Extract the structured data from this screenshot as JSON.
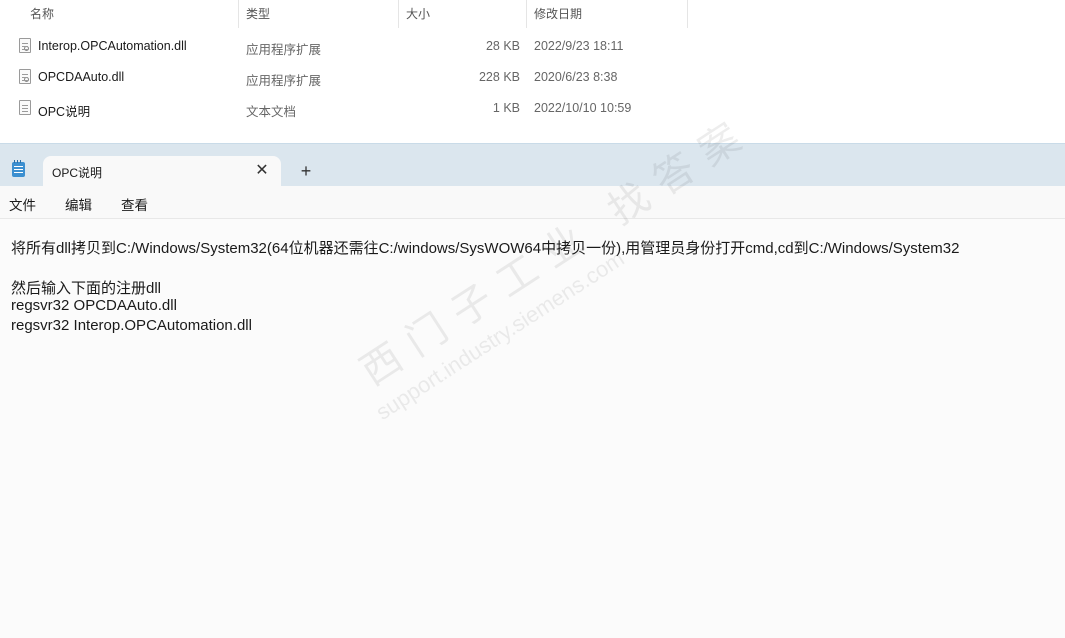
{
  "explorer": {
    "columns": {
      "name": "名称",
      "type": "类型",
      "size": "大小",
      "date": "修改日期"
    },
    "files": [
      {
        "name": "Interop.OPCAutomation.dll",
        "type": "应用程序扩展",
        "size": "28 KB",
        "date": "2022/9/23 18:11",
        "icon": "dll-file-icon"
      },
      {
        "name": "OPCDAAuto.dll",
        "type": "应用程序扩展",
        "size": "228 KB",
        "date": "2020/6/23 8:38",
        "icon": "dll-file-icon"
      },
      {
        "name": "OPC说明",
        "type": "文本文档",
        "size": "1 KB",
        "date": "2022/10/10 10:59",
        "icon": "text-file-icon"
      }
    ]
  },
  "notepad": {
    "tab_title": "OPC说明",
    "close_glyph": "✕",
    "add_glyph": "+",
    "menu": [
      "文件",
      "编辑",
      "查看"
    ],
    "lines": [
      "将所有dll拷贝到C:/Windows/System32(64位机器还需往C:/windows/SysWOW64中拷贝一份),用管理员身份打开cmd,cd到C:/Windows/System32",
      "",
      "然后输入下面的注册dll",
      "regsvr32 OPCDAAuto.dll",
      "regsvr32 Interop.OPCAutomation.dll"
    ]
  },
  "watermark": {
    "text_cn": "西门子工业 找答案",
    "url": "support.industry.siemens.com"
  }
}
